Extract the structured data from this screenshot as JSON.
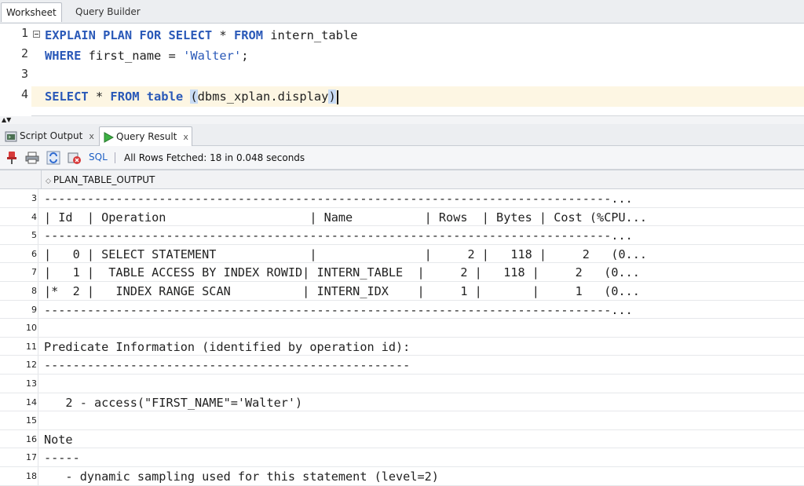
{
  "tabs": {
    "worksheet": "Worksheet",
    "query_builder": "Query Builder"
  },
  "editor": {
    "line_numbers": [
      "1",
      "2",
      "3",
      "4"
    ],
    "line1": {
      "kw1": "EXPLAIN PLAN FOR SELECT",
      "star": " * ",
      "kw2": "FROM",
      "rest": " intern_table"
    },
    "line2": {
      "kw1": "WHERE",
      "mid": " first_name = ",
      "str": "'Walter'",
      "end": ";"
    },
    "line4": {
      "kw1": "SELECT",
      "star": " * ",
      "kw2": "FROM",
      "kw3": " table ",
      "paren_open": "(",
      "body": "dbms_xplan.display",
      "paren_close": ")"
    }
  },
  "result_tabs": {
    "script_output": "Script Output",
    "query_result": "Query Result",
    "close_glyph": "x"
  },
  "toolbar": {
    "sql_label": "SQL",
    "fetch_status": "All Rows Fetched: 18 in 0.048 seconds"
  },
  "grid": {
    "column_header": "PLAN_TABLE_OUTPUT",
    "rows": [
      {
        "num": "3",
        "text": "-------------------------------------------------------------------------------..."
      },
      {
        "num": "4",
        "text": "| Id  | Operation                    | Name          | Rows  | Bytes | Cost (%CPU..."
      },
      {
        "num": "5",
        "text": "-------------------------------------------------------------------------------..."
      },
      {
        "num": "6",
        "text": "|   0 | SELECT STATEMENT             |               |     2 |   118 |     2   (0..."
      },
      {
        "num": "7",
        "text": "|   1 |  TABLE ACCESS BY INDEX ROWID| INTERN_TABLE  |     2 |   118 |     2   (0..."
      },
      {
        "num": "8",
        "text": "|*  2 |   INDEX RANGE SCAN          | INTERN_IDX    |     1 |       |     1   (0..."
      },
      {
        "num": "9",
        "text": "-------------------------------------------------------------------------------..."
      },
      {
        "num": "10",
        "text": ""
      },
      {
        "num": "11",
        "text": "Predicate Information (identified by operation id):"
      },
      {
        "num": "12",
        "text": "---------------------------------------------------"
      },
      {
        "num": "13",
        "text": ""
      },
      {
        "num": "14",
        "text": "   2 - access(\"FIRST_NAME\"='Walter')"
      },
      {
        "num": "15",
        "text": ""
      },
      {
        "num": "16",
        "text": "Note"
      },
      {
        "num": "17",
        "text": "-----"
      },
      {
        "num": "18",
        "text": "   - dynamic sampling used for this statement (level=2)"
      }
    ]
  },
  "colors": {
    "keyword": "#2a59b8",
    "current_line": "#fdf6e3",
    "sql_link": "#1d5fc4"
  }
}
